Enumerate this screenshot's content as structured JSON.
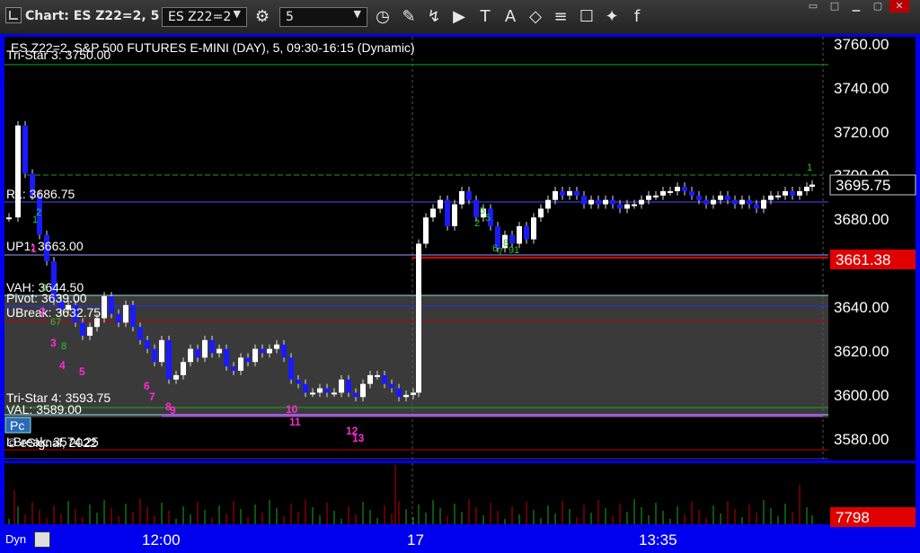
{
  "window": {
    "title": "Chart: ES Z22=2, 5",
    "symbol_value": "ES Z22=2",
    "interval_value": "5"
  },
  "toolbar_icons": [
    "settings-icon",
    "clock-icon",
    "pencil-icon",
    "line-draw-icon",
    "play-icon",
    "text-tool-icon",
    "alert-icon",
    "eraser-icon",
    "indicator-icon",
    "comment-icon",
    "twitter-icon",
    "facebook-icon"
  ],
  "chart": {
    "header": "ES Z22=2, S&P 500 FUTURES E-MINI (DAY), 5, 09:30-16:15 (Dynamic)",
    "copyright": "© eSignal, 2022",
    "price_axis": [
      "3760.00",
      "3740.00",
      "3720.00",
      "3700.00",
      "3680.00",
      "3660.00",
      "3640.00",
      "3620.00",
      "3600.00",
      "3580.00"
    ],
    "current_price": "3695.75",
    "highlight_price": "3661.38",
    "volume_value": "7798",
    "time_axis": [
      "12:00",
      "17",
      "13:35"
    ],
    "level_labels": {
      "tristar3": "Tri-Star 3: 3750.00",
      "r1": "R1: 3686.75",
      "up": "UP1: 3663.00",
      "vah": "VAH: 3644.50",
      "pivot": "Pivot: 3639.00",
      "ubreak": "UBreak: 3632.75",
      "tristar4": "Tri-Star 4: 3593.75",
      "val": "VAL: 3589.00",
      "pc": "Pc",
      "lbreak": "LBreak: 3574.25"
    },
    "ylim": [
      3574,
      3764
    ],
    "count_labels_magenta": [
      "1",
      "2",
      "3",
      "4",
      "5",
      "6",
      "7",
      "8",
      "9",
      "10",
      "11",
      "12",
      "13"
    ],
    "count_labels_green": [
      "1",
      "2",
      "3",
      "6",
      "7",
      "8",
      "1",
      "2",
      "3",
      "5",
      "6",
      "7",
      "8",
      "9",
      "1"
    ]
  },
  "bottom": {
    "dyn_label": "Dyn",
    "icon": "chart-pc-icon"
  },
  "colors": {
    "up_candle": "#ffffff",
    "down_candle": "#1a1aff",
    "background": "#000000",
    "frame": "#0000ee",
    "highlight": "#e00000"
  }
}
